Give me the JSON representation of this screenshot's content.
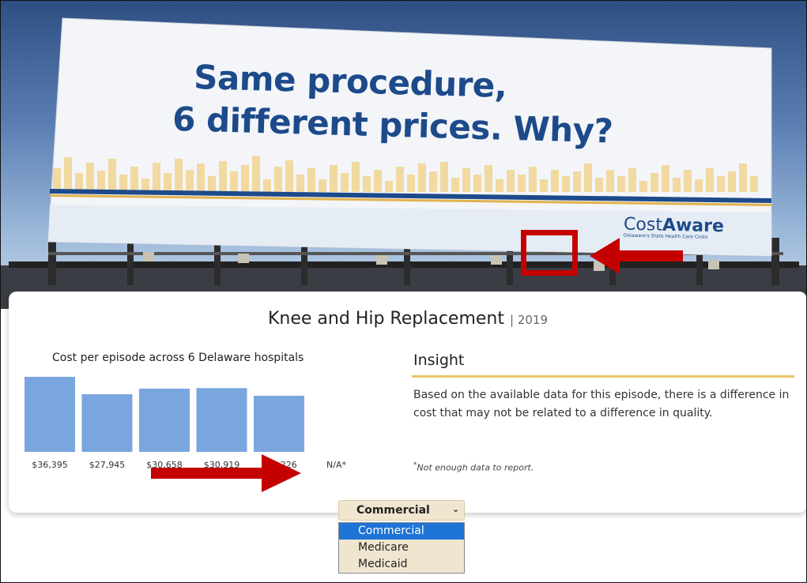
{
  "billboard": {
    "headline_line1": "Same procedure,",
    "headline_line2": "6 different prices. Why?",
    "brand_part1": "Cost",
    "brand_part2": "Aware",
    "brand_tagline": "Delaware's State Health Care Costs"
  },
  "card": {
    "title": "Knee and Hip Replacement",
    "year": "| 2019"
  },
  "chart_data": {
    "type": "bar",
    "title": "Cost per episode across 6 Delaware hospitals",
    "categories": [
      "$36,395",
      "$27,945",
      "$30,658",
      "$30,919",
      "$27,226",
      "N/A*"
    ],
    "values": [
      36395,
      27945,
      30658,
      30919,
      27226,
      null
    ],
    "bar_color": "#7aa6df",
    "xlabel": "",
    "ylabel": "",
    "ylim": [
      0,
      36395
    ]
  },
  "insight": {
    "heading": "Insight",
    "body": "Based on the available data for this episode, there is a difference in cost that may not be related to a difference in quality.",
    "footnote_mark": "*",
    "footnote_text": "Not enough data to report."
  },
  "payer_select": {
    "value": "Commercial",
    "options": [
      "Commercial",
      "Medicare",
      "Medicaid"
    ],
    "selected_index": 0
  },
  "colors": {
    "annotation_red": "#c40000",
    "brand_blue": "#1d4a8a",
    "accent_gold": "#e8c36a"
  }
}
